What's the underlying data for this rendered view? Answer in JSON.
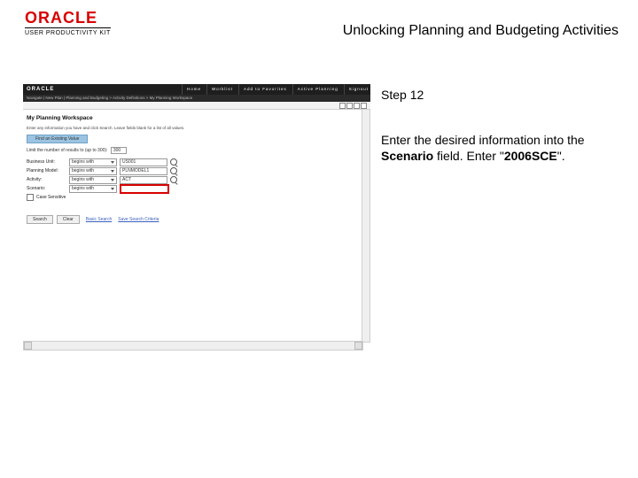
{
  "header": {
    "logo_brand": "ORACLE",
    "logo_subline": "USER PRODUCTIVITY KIT",
    "page_title": "Unlocking Planning and Budgeting Activities"
  },
  "instructions": {
    "step_label": "Step 12",
    "body_prefix": "Enter the desired information into the ",
    "field_name": "Scenario",
    "body_mid": " field. Enter \"",
    "entry_value": "2006SCE",
    "body_suffix": "\"."
  },
  "app": {
    "brand": "ORACLE",
    "breadcrumbs": "Navigate  |  New Plan  |  Planning and Budgeting  >  Activity Definitions   >   My Planning Workspace",
    "top_menu": [
      "Home",
      "Worklist",
      "Add to Favorites",
      "Active Planning",
      "Signout"
    ],
    "workspace_title": "My Planning Workspace",
    "workspace_sub": "Enter any information you have and click Search. Leave fields blank for a list of all values.",
    "tab_label": "Find an Existing Value",
    "limit_label": "Limit the number of results to (up to 300):",
    "limit_value": "300",
    "op_default": "begins with",
    "rows": [
      {
        "label": "Business Unit:",
        "value": "US001"
      },
      {
        "label": "Planning Model:",
        "value": "PLNMODEL1"
      },
      {
        "label": "Activity:",
        "value": "ACT"
      },
      {
        "label": "Scenario:",
        "value": ""
      }
    ],
    "case_label": "Case Sensitive",
    "buttons": {
      "search": "Search",
      "clear": "Clear"
    },
    "links": {
      "basic": "Basic Search",
      "save": "Save Search Criteria"
    }
  }
}
